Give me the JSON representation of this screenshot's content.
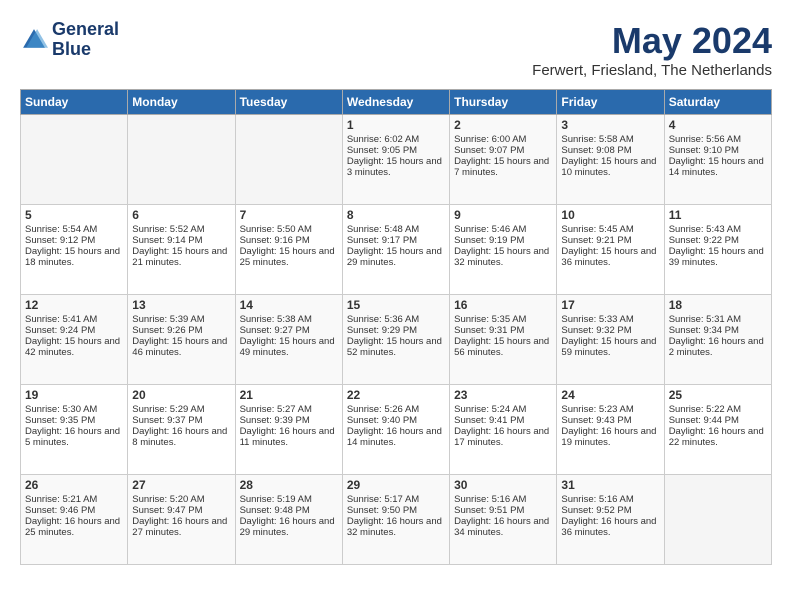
{
  "header": {
    "logo_line1": "General",
    "logo_line2": "Blue",
    "title": "May 2024",
    "subtitle": "Ferwert, Friesland, The Netherlands"
  },
  "weekdays": [
    "Sunday",
    "Monday",
    "Tuesday",
    "Wednesday",
    "Thursday",
    "Friday",
    "Saturday"
  ],
  "weeks": [
    [
      {
        "day": "",
        "empty": true
      },
      {
        "day": "",
        "empty": true
      },
      {
        "day": "",
        "empty": true
      },
      {
        "day": "1",
        "sunrise": "6:02 AM",
        "sunset": "9:05 PM",
        "daylight": "15 hours and 3 minutes."
      },
      {
        "day": "2",
        "sunrise": "6:00 AM",
        "sunset": "9:07 PM",
        "daylight": "15 hours and 7 minutes."
      },
      {
        "day": "3",
        "sunrise": "5:58 AM",
        "sunset": "9:08 PM",
        "daylight": "15 hours and 10 minutes."
      },
      {
        "day": "4",
        "sunrise": "5:56 AM",
        "sunset": "9:10 PM",
        "daylight": "15 hours and 14 minutes."
      }
    ],
    [
      {
        "day": "5",
        "sunrise": "5:54 AM",
        "sunset": "9:12 PM",
        "daylight": "15 hours and 18 minutes."
      },
      {
        "day": "6",
        "sunrise": "5:52 AM",
        "sunset": "9:14 PM",
        "daylight": "15 hours and 21 minutes."
      },
      {
        "day": "7",
        "sunrise": "5:50 AM",
        "sunset": "9:16 PM",
        "daylight": "15 hours and 25 minutes."
      },
      {
        "day": "8",
        "sunrise": "5:48 AM",
        "sunset": "9:17 PM",
        "daylight": "15 hours and 29 minutes."
      },
      {
        "day": "9",
        "sunrise": "5:46 AM",
        "sunset": "9:19 PM",
        "daylight": "15 hours and 32 minutes."
      },
      {
        "day": "10",
        "sunrise": "5:45 AM",
        "sunset": "9:21 PM",
        "daylight": "15 hours and 36 minutes."
      },
      {
        "day": "11",
        "sunrise": "5:43 AM",
        "sunset": "9:22 PM",
        "daylight": "15 hours and 39 minutes."
      }
    ],
    [
      {
        "day": "12",
        "sunrise": "5:41 AM",
        "sunset": "9:24 PM",
        "daylight": "15 hours and 42 minutes."
      },
      {
        "day": "13",
        "sunrise": "5:39 AM",
        "sunset": "9:26 PM",
        "daylight": "15 hours and 46 minutes."
      },
      {
        "day": "14",
        "sunrise": "5:38 AM",
        "sunset": "9:27 PM",
        "daylight": "15 hours and 49 minutes."
      },
      {
        "day": "15",
        "sunrise": "5:36 AM",
        "sunset": "9:29 PM",
        "daylight": "15 hours and 52 minutes."
      },
      {
        "day": "16",
        "sunrise": "5:35 AM",
        "sunset": "9:31 PM",
        "daylight": "15 hours and 56 minutes."
      },
      {
        "day": "17",
        "sunrise": "5:33 AM",
        "sunset": "9:32 PM",
        "daylight": "15 hours and 59 minutes."
      },
      {
        "day": "18",
        "sunrise": "5:31 AM",
        "sunset": "9:34 PM",
        "daylight": "16 hours and 2 minutes."
      }
    ],
    [
      {
        "day": "19",
        "sunrise": "5:30 AM",
        "sunset": "9:35 PM",
        "daylight": "16 hours and 5 minutes."
      },
      {
        "day": "20",
        "sunrise": "5:29 AM",
        "sunset": "9:37 PM",
        "daylight": "16 hours and 8 minutes."
      },
      {
        "day": "21",
        "sunrise": "5:27 AM",
        "sunset": "9:39 PM",
        "daylight": "16 hours and 11 minutes."
      },
      {
        "day": "22",
        "sunrise": "5:26 AM",
        "sunset": "9:40 PM",
        "daylight": "16 hours and 14 minutes."
      },
      {
        "day": "23",
        "sunrise": "5:24 AM",
        "sunset": "9:41 PM",
        "daylight": "16 hours and 17 minutes."
      },
      {
        "day": "24",
        "sunrise": "5:23 AM",
        "sunset": "9:43 PM",
        "daylight": "16 hours and 19 minutes."
      },
      {
        "day": "25",
        "sunrise": "5:22 AM",
        "sunset": "9:44 PM",
        "daylight": "16 hours and 22 minutes."
      }
    ],
    [
      {
        "day": "26",
        "sunrise": "5:21 AM",
        "sunset": "9:46 PM",
        "daylight": "16 hours and 25 minutes."
      },
      {
        "day": "27",
        "sunrise": "5:20 AM",
        "sunset": "9:47 PM",
        "daylight": "16 hours and 27 minutes."
      },
      {
        "day": "28",
        "sunrise": "5:19 AM",
        "sunset": "9:48 PM",
        "daylight": "16 hours and 29 minutes."
      },
      {
        "day": "29",
        "sunrise": "5:17 AM",
        "sunset": "9:50 PM",
        "daylight": "16 hours and 32 minutes."
      },
      {
        "day": "30",
        "sunrise": "5:16 AM",
        "sunset": "9:51 PM",
        "daylight": "16 hours and 34 minutes."
      },
      {
        "day": "31",
        "sunrise": "5:16 AM",
        "sunset": "9:52 PM",
        "daylight": "16 hours and 36 minutes."
      },
      {
        "day": "",
        "empty": true
      }
    ]
  ]
}
